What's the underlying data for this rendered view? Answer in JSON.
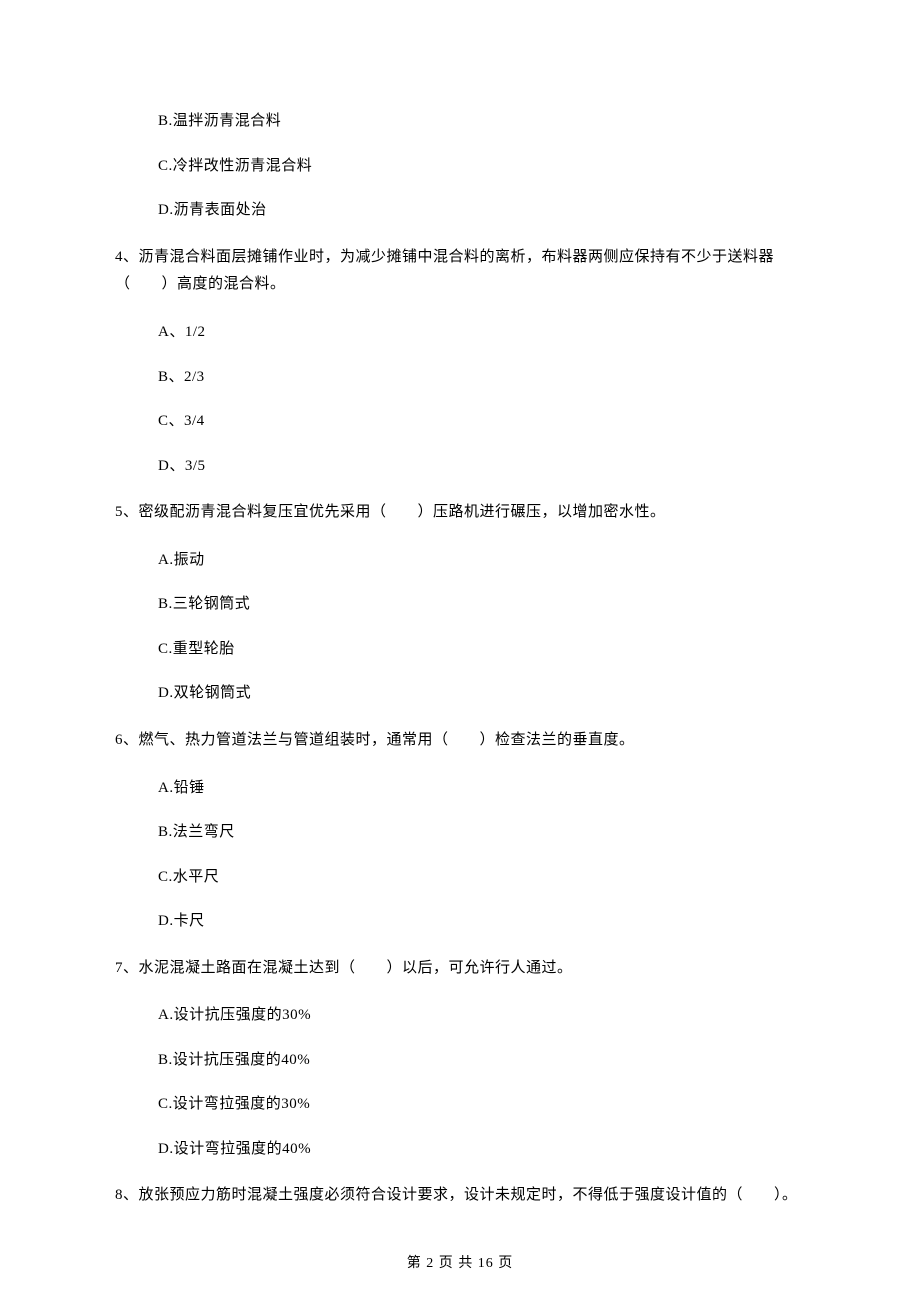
{
  "q3": {
    "optB": "B.温拌沥青混合料",
    "optC": "C.冷拌改性沥青混合料",
    "optD": "D.沥青表面处治"
  },
  "q4": {
    "text": "4、沥青混合料面层摊铺作业时，为减少摊铺中混合料的离析，布料器两侧应保持有不少于送料器（　　）高度的混合料。",
    "optA": "A、1/2",
    "optB": "B、2/3",
    "optC": "C、3/4",
    "optD": "D、3/5"
  },
  "q5": {
    "text": "5、密级配沥青混合料复压宜优先采用（　　）压路机进行碾压，以增加密水性。",
    "optA": "A.振动",
    "optB": "B.三轮钢筒式",
    "optC": "C.重型轮胎",
    "optD": "D.双轮钢筒式"
  },
  "q6": {
    "text": "6、燃气、热力管道法兰与管道组装时，通常用（　　）检查法兰的垂直度。",
    "optA": "A.铅锤",
    "optB": "B.法兰弯尺",
    "optC": "C.水平尺",
    "optD": "D.卡尺"
  },
  "q7": {
    "text": "7、水泥混凝土路面在混凝土达到（　　）以后，可允许行人通过。",
    "optA": "A.设计抗压强度的30%",
    "optB": "B.设计抗压强度的40%",
    "optC": "C.设计弯拉强度的30%",
    "optD": "D.设计弯拉强度的40%"
  },
  "q8": {
    "text": "8、放张预应力筋时混凝土强度必须符合设计要求，设计未规定时，不得低于强度设计值的（　　）。"
  },
  "footer": "第 2 页 共 16 页"
}
